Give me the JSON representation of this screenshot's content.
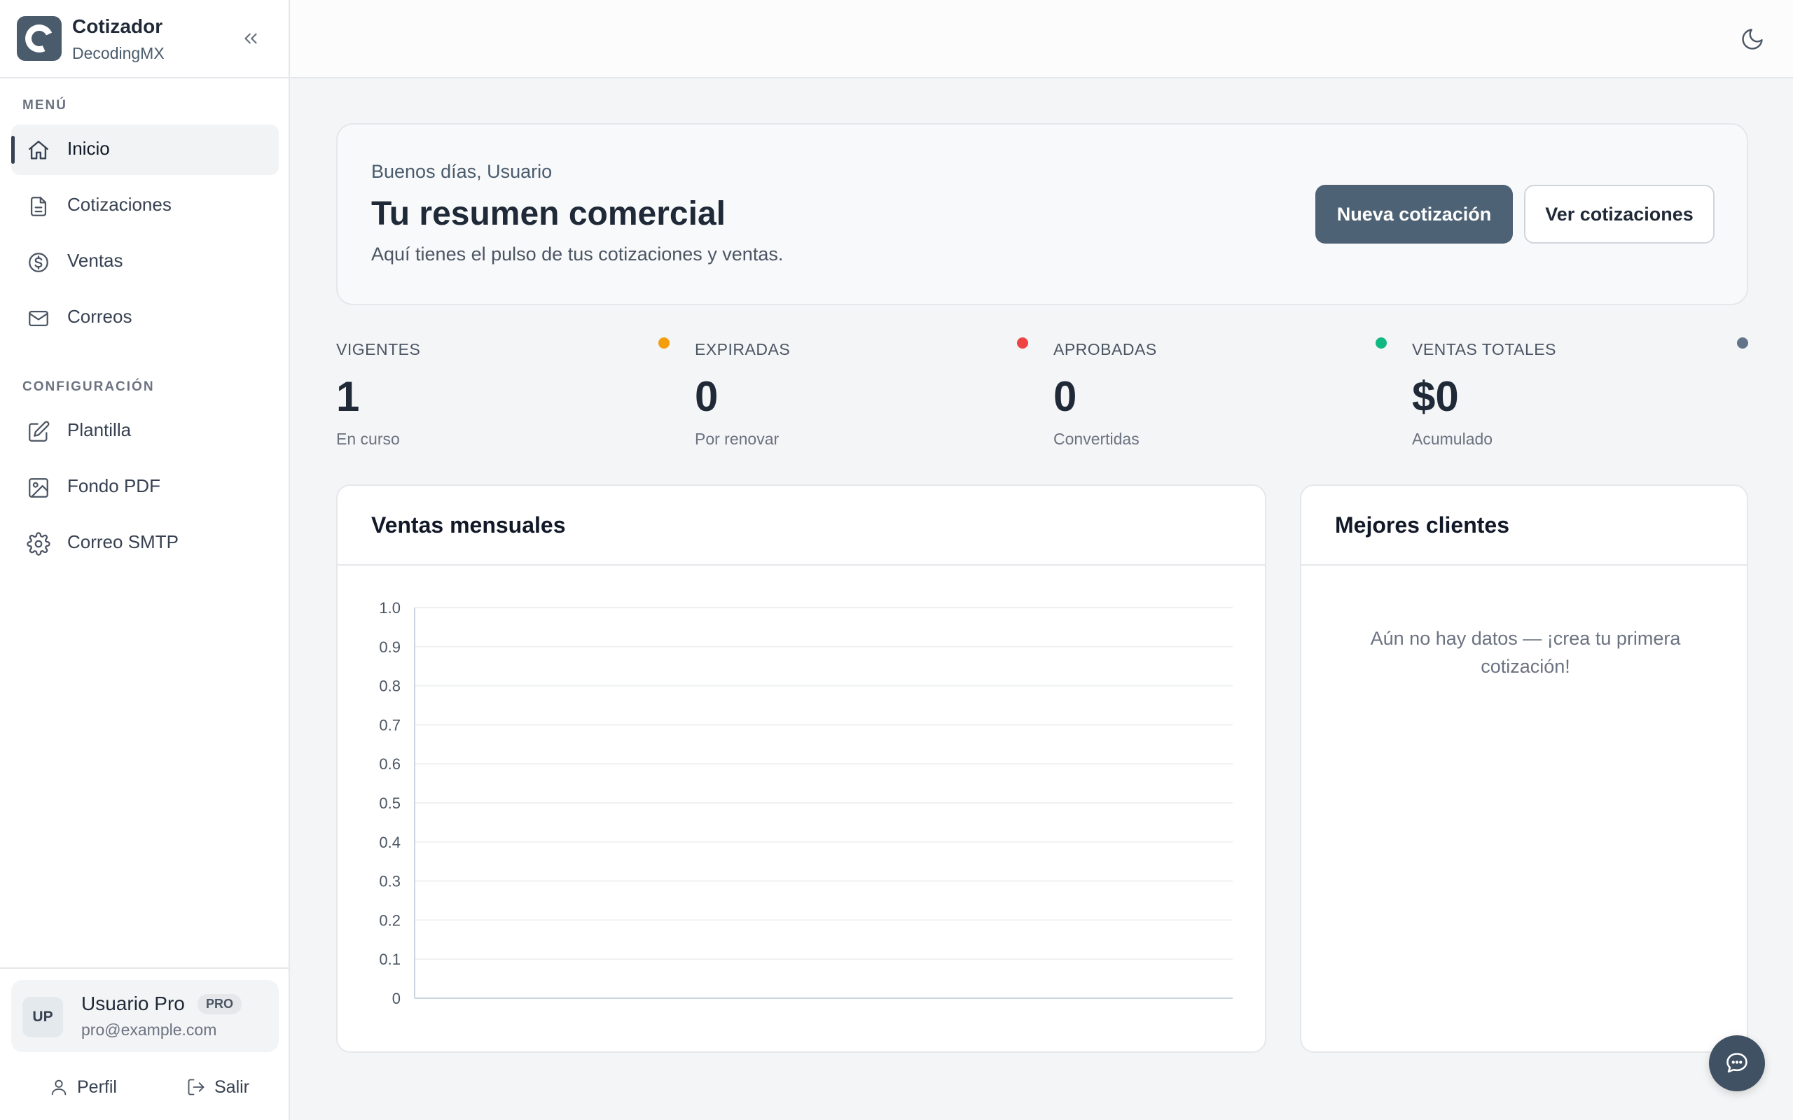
{
  "app": {
    "title": "Cotizador",
    "org": "DecodingMX"
  },
  "sidebar": {
    "menu_label": "MENÚ",
    "menu_items": [
      {
        "label": "Inicio",
        "icon": "home-icon",
        "active": true
      },
      {
        "label": "Cotizaciones",
        "icon": "document-icon"
      },
      {
        "label": "Ventas",
        "icon": "dollar-icon"
      },
      {
        "label": "Correos",
        "icon": "mail-icon"
      }
    ],
    "config_label": "CONFIGURACIÓN",
    "config_items": [
      {
        "label": "Plantilla",
        "icon": "edit-icon"
      },
      {
        "label": "Fondo PDF",
        "icon": "image-icon"
      },
      {
        "label": "Correo SMTP",
        "icon": "gear-icon"
      }
    ]
  },
  "user": {
    "initials": "UP",
    "name": "Usuario Pro",
    "badge": "PRO",
    "email": "pro@example.com",
    "profile_label": "Perfil",
    "logout_label": "Salir"
  },
  "hero": {
    "greeting": "Buenos días, Usuario",
    "title": "Tu resumen comercial",
    "description": "Aquí tienes el pulso de tus cotizaciones y ventas.",
    "primary_label": "Nueva cotización",
    "secondary_label": "Ver cotizaciones"
  },
  "stats": [
    {
      "label": "VIGENTES",
      "value": "1",
      "sub": "En curso",
      "color": "#f59e0b"
    },
    {
      "label": "EXPIRADAS",
      "value": "0",
      "sub": "Por renovar",
      "color": "#ef4444"
    },
    {
      "label": "APROBADAS",
      "value": "0",
      "sub": "Convertidas",
      "color": "#10b981"
    },
    {
      "label": "VENTAS TOTALES",
      "value": "$0",
      "sub": "Acumulado",
      "color": "#64748b"
    }
  ],
  "sales_card": {
    "title": "Ventas mensuales"
  },
  "clients_card": {
    "title": "Mejores clientes",
    "empty_text": "Aún no hay datos — ¡crea tu primera cotización!"
  },
  "chart_data": {
    "type": "bar",
    "title": "",
    "categories": [],
    "values": [],
    "ylim": [
      0,
      1.0
    ],
    "yticks": [
      "0",
      "0.1",
      "0.2",
      "0.3",
      "0.4",
      "0.5",
      "0.6",
      "0.7",
      "0.8",
      "0.9",
      "1.0"
    ],
    "grid": true
  },
  "colors": {
    "accent": "#4e6275",
    "sidebar_bg": "#ffffff",
    "page_bg": "#f4f5f6"
  }
}
